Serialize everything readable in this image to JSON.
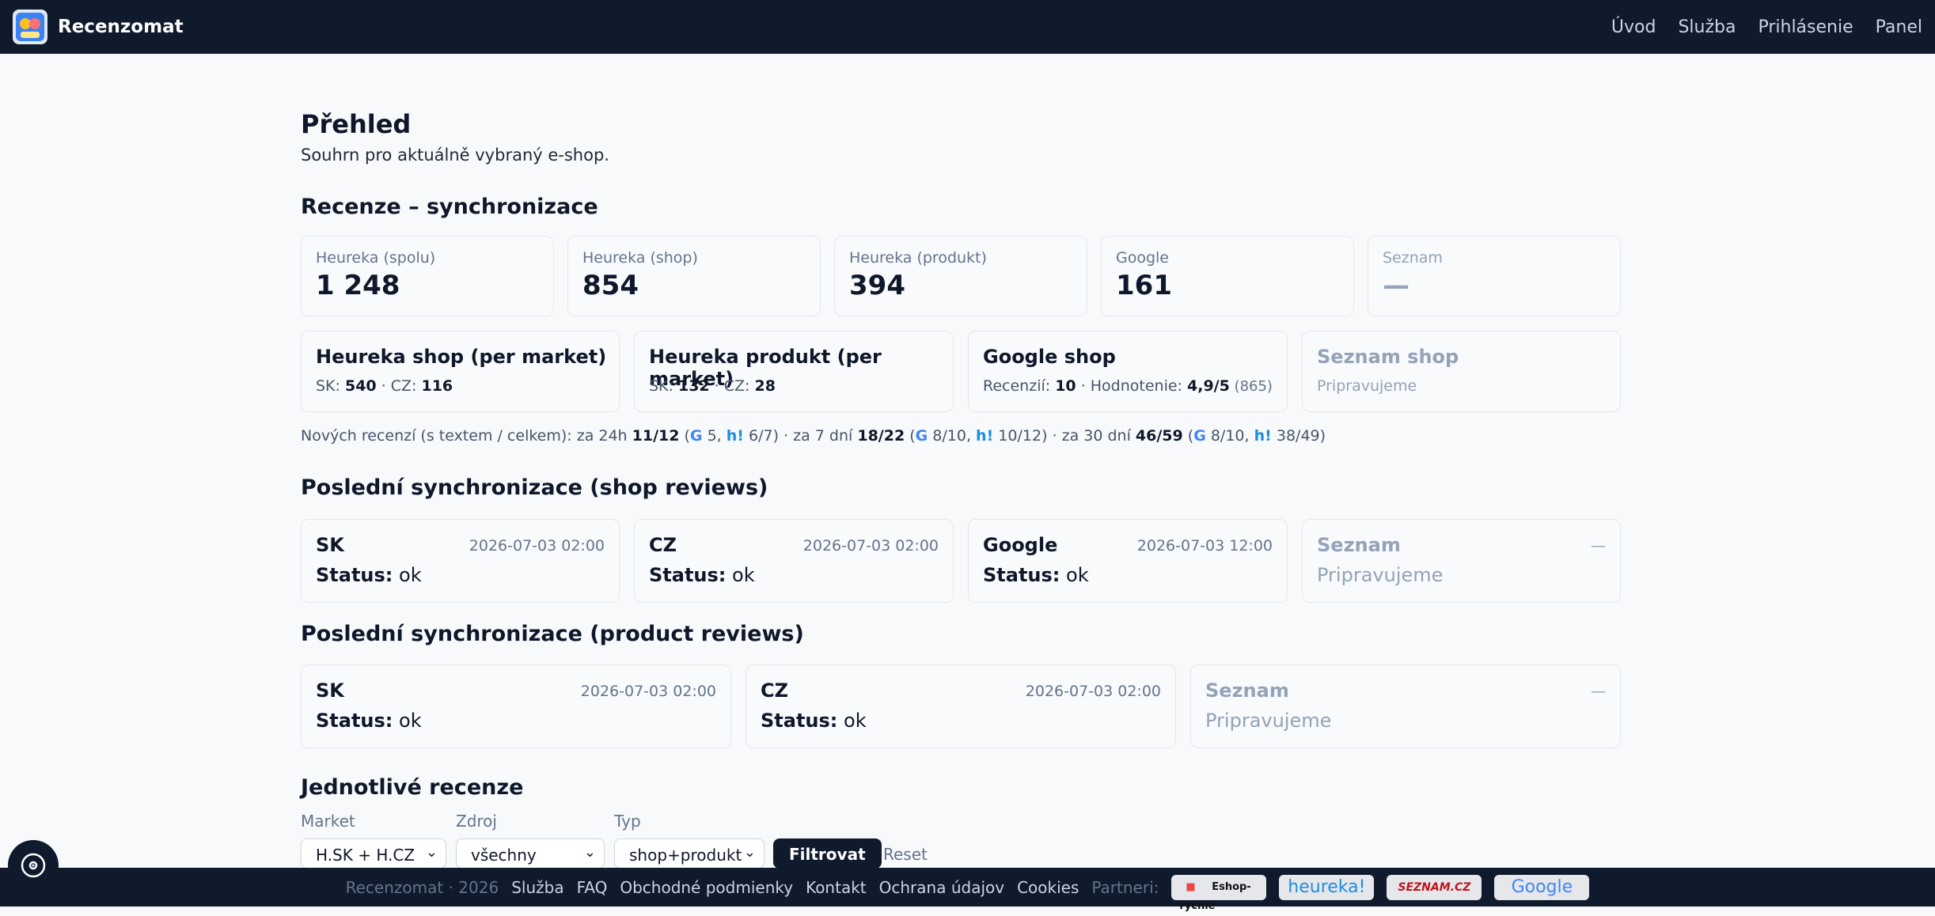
{
  "app": {
    "brand": "Recenzomat"
  },
  "nav": [
    "Úvod",
    "Služba",
    "Prihlásenie",
    "Panel"
  ],
  "page": {
    "title": "Přehled",
    "subtitle": "Souhrn pro aktuálně vybraný e-shop."
  },
  "sections": {
    "sync_title": "Recenze – synchronizace",
    "shop_sync_title": "Poslední synchronizace (shop reviews)",
    "product_sync_title": "Poslední synchronizace (product reviews)",
    "individual_title": "Jednotlivé recenze"
  },
  "stats": [
    {
      "label": "Heureka (spolu)",
      "value": "1 248"
    },
    {
      "label": "Heureka (shop)",
      "value": "854"
    },
    {
      "label": "Heureka (produkt)",
      "value": "394"
    },
    {
      "label": "Google",
      "value": "161"
    },
    {
      "label": "Seznam",
      "value": "—"
    }
  ],
  "market_cards": [
    {
      "title": "Heureka shop (per market)",
      "p1": "SK: ",
      "v1": "540",
      "p2": " · CZ: ",
      "v2": "116",
      "p3": ""
    },
    {
      "title": "Heureka produkt (per market)",
      "p1": "SK: ",
      "v1": "132",
      "p2": " · CZ: ",
      "v2": "28",
      "p3": ""
    },
    {
      "title": "Google shop",
      "p1": "Recenzií: ",
      "v1": "10",
      "p2": " · Hodnotenie: ",
      "v2": "4,9/5",
      "p3": " (865)"
    },
    {
      "title": "Seznam shop",
      "text": "Pripravujeme"
    }
  ],
  "new_reviews": {
    "prefix": "Nových recenzí (s textem / celkem): za 24h ",
    "d24": "11/12",
    "d24_g": "5",
    "d24_h": "6/7",
    "mid7": " · za 7 dní ",
    "d7": "18/22",
    "d7_g": "8/10",
    "d7_h": "10/12",
    "mid30": " · za 30 dní ",
    "d30": "46/59",
    "d30_g": "8/10",
    "d30_h": "38/49"
  },
  "shop_sync": [
    {
      "name": "SK",
      "date": "2026-07-03 02:00",
      "status_label": "Status:",
      "status": "ok"
    },
    {
      "name": "CZ",
      "date": "2026-07-03 02:00",
      "status_label": "Status:",
      "status": "ok"
    },
    {
      "name": "Google",
      "date": "2026-07-03 12:00",
      "status_label": "Status:",
      "status": "ok"
    },
    {
      "name": "Seznam",
      "date": "—",
      "status": "Pripravujeme"
    }
  ],
  "product_sync": [
    {
      "name": "SK",
      "date": "2026-07-03 02:00",
      "status_label": "Status:",
      "status": "ok"
    },
    {
      "name": "CZ",
      "date": "2026-07-03 02:00",
      "status_label": "Status:",
      "status": "ok"
    },
    {
      "name": "Seznam",
      "date": "—",
      "status": "Pripravujeme"
    }
  ],
  "filters": {
    "market_label": "Market",
    "market_value": "H.SK + H.CZ",
    "source_label": "Zdroj",
    "source_value": "všechny",
    "type_label": "Typ",
    "type_value": "shop+produkt",
    "filter_button": "Filtrovat",
    "reset": "Reset"
  },
  "footer": {
    "copy": "Recenzomat · 2026",
    "links": [
      "Služba",
      "FAQ",
      "Obchodné podmienky",
      "Kontakt",
      "Ochrana údajov",
      "Cookies"
    ],
    "partners_label": "Partneri:",
    "partners": [
      "Eshop-rychle",
      "heureka!",
      "SEZNAM.CZ",
      "Google"
    ]
  },
  "colors": {
    "nav_bg": "#0f1a2d",
    "page_bg": "#f7f9fb",
    "google_blue": "#4285f4",
    "heureka_blue": "#1d8fe0"
  }
}
